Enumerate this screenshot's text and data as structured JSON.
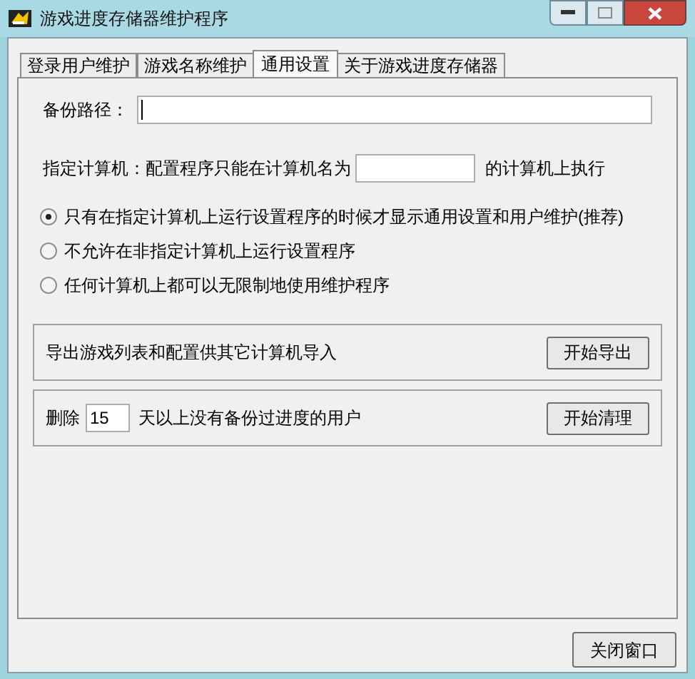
{
  "window": {
    "title": "游戏进度存储器维护程序"
  },
  "tabs": [
    {
      "label": "登录用户维护",
      "selected": false
    },
    {
      "label": "游戏名称维护",
      "selected": false
    },
    {
      "label": "通用设置",
      "selected": true
    },
    {
      "label": "关于游戏进度存储器",
      "selected": false
    }
  ],
  "backup_path": {
    "label": "备份路径："
  },
  "computer": {
    "label": "指定计算机：配置程序只能在计算机名为",
    "suffix": "的计算机上执行"
  },
  "options": [
    {
      "label": "只有在指定计算机上运行设置程序的时候才显示通用设置和用户维护(推荐)",
      "selected": true
    },
    {
      "label": "不允许在非指定计算机上运行设置程序",
      "selected": false
    },
    {
      "label": "任何计算机上都可以无限制地使用维护程序",
      "selected": false
    }
  ],
  "export_group": {
    "text": "导出游戏列表和配置供其它计算机导入",
    "button": "开始导出"
  },
  "cleanup_group": {
    "prefix": "删除",
    "days": "15",
    "suffix": "天以上没有备份过进度的用户",
    "button": "开始清理"
  },
  "close_button": "关闭窗口"
}
